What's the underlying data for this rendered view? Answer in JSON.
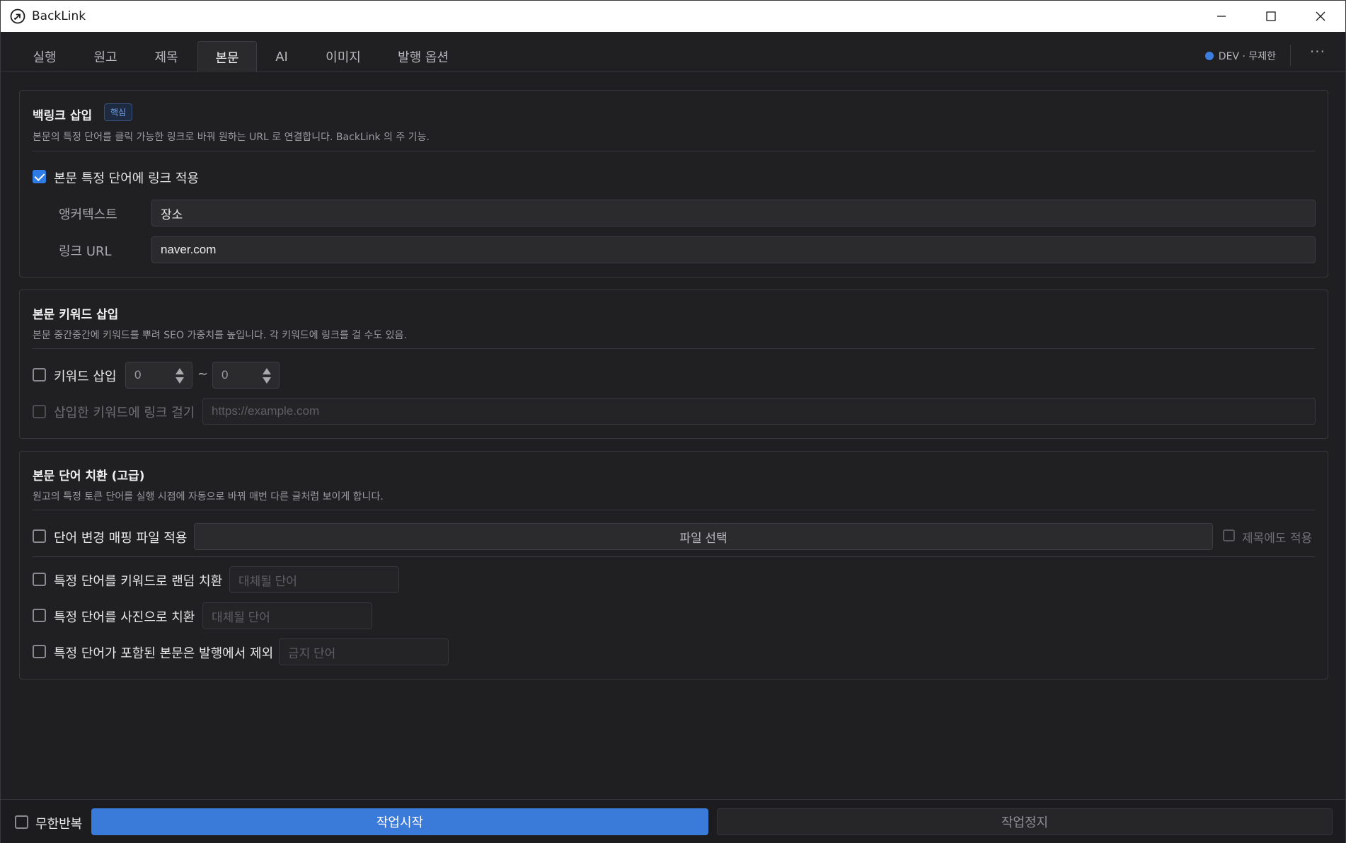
{
  "window": {
    "title": "BackLink",
    "controls": [
      "minimize-icon",
      "maximize-icon",
      "close-icon"
    ]
  },
  "tabs": [
    {
      "label": "실행",
      "active": false
    },
    {
      "label": "원고",
      "active": false
    },
    {
      "label": "제목",
      "active": false
    },
    {
      "label": "본문",
      "active": true
    },
    {
      "label": "AI",
      "active": false
    },
    {
      "label": "이미지",
      "active": false
    },
    {
      "label": "발행 옵션",
      "active": false
    }
  ],
  "status": {
    "text": "DEV · 무제한",
    "dot_color": "#3c7ee0"
  },
  "more_label": "···",
  "backlink": {
    "title": "백링크 삽입",
    "badge": "핵심",
    "description": "본문의 특정 단어를 클릭 가능한 링크로 바꿔 원하는 URL 로 연결합니다. BackLink 의 주 기능.",
    "apply_label": "본문 특정 단어에 링크 적용",
    "apply_checked": true,
    "anchor_label": "앵커텍스트",
    "anchor_value": "장소",
    "url_label": "링크 URL",
    "url_value": "naver.com"
  },
  "keyword": {
    "title": "본문 키워드 삽입",
    "description": "본문 중간중간에 키워드를 뿌려 SEO 가중치를 높입니다. 각 키워드에 링크를 걸 수도 있음.",
    "insert_label": "키워드 삽입",
    "insert_checked": false,
    "min_value": "0",
    "range_separator": "~",
    "max_value": "0",
    "link_label": "삽입한 키워드에 링크 걸기",
    "link_checked": false,
    "link_placeholder": "https://example.com"
  },
  "replace": {
    "title": "본문 단어 치환 (고급)",
    "description": "원고의 특정 토큰 단어를 실행 시점에 자동으로 바꿔 매번 다른 글처럼 보이게 합니다.",
    "mapping_label": "단어 변경 매핑 파일 적용",
    "mapping_checked": false,
    "file_button": "파일 선택",
    "title_apply_label": "제목에도 적용",
    "title_apply_checked": false,
    "random_label": "특정 단어를 키워드로 랜덤 치환",
    "random_placeholder": "대체될 단어",
    "photo_label": "특정 단어를 사진으로 치환",
    "photo_placeholder": "대체될 단어",
    "exclude_label": "특정 단어가 포함된 본문은 발행에서 제외",
    "exclude_placeholder": "금지 단어"
  },
  "footer": {
    "repeat_label": "무한반복",
    "repeat_checked": false,
    "start_label": "작업시작",
    "stop_label": "작업정지",
    "start_color": "#3a7ad9"
  }
}
